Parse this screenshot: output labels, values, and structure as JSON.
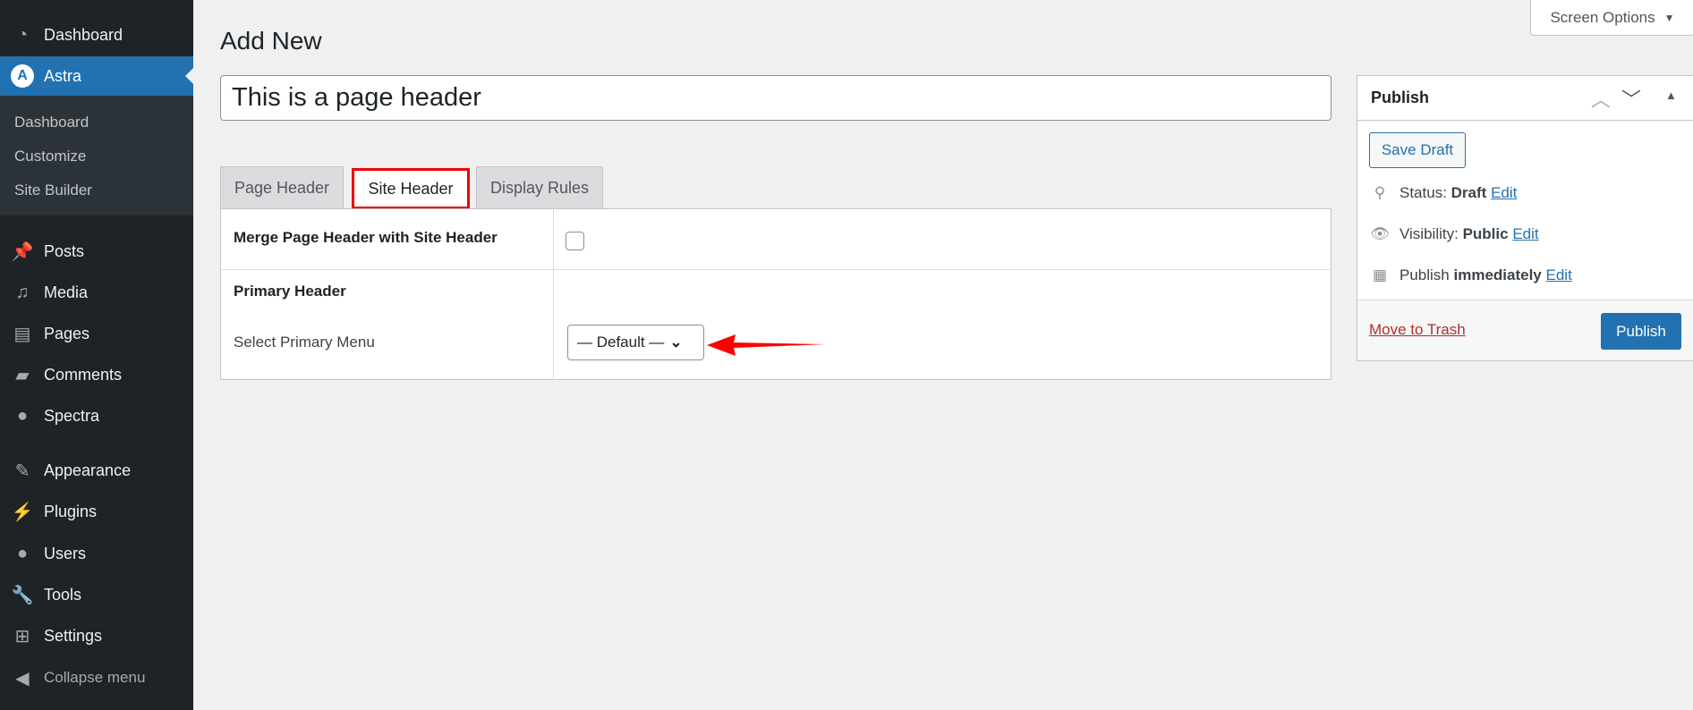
{
  "sidebar": {
    "items": [
      {
        "label": "Dashboard",
        "icon": "dashboard-icon"
      },
      {
        "label": "Astra",
        "icon": "astra-icon"
      },
      {
        "label": "Posts",
        "icon": "pin-icon"
      },
      {
        "label": "Media",
        "icon": "media-icon"
      },
      {
        "label": "Pages",
        "icon": "pages-icon"
      },
      {
        "label": "Comments",
        "icon": "comments-icon"
      },
      {
        "label": "Spectra",
        "icon": "spectra-icon"
      },
      {
        "label": "Appearance",
        "icon": "brush-icon"
      },
      {
        "label": "Plugins",
        "icon": "plugin-icon"
      },
      {
        "label": "Users",
        "icon": "user-icon"
      },
      {
        "label": "Tools",
        "icon": "wrench-icon"
      },
      {
        "label": "Settings",
        "icon": "settings-icon"
      }
    ],
    "submenu": [
      "Dashboard",
      "Customize",
      "Site Builder"
    ],
    "collapse": "Collapse menu"
  },
  "page": {
    "title": "Add New",
    "post_title": "This is a page header",
    "screen_options": "Screen Options"
  },
  "tabs": [
    "Page Header",
    "Site Header",
    "Display Rules"
  ],
  "settings": {
    "merge_label": "Merge Page Header with Site Header",
    "merge_checked": false,
    "primary_header": "Primary Header",
    "select_menu_label": "Select Primary Menu",
    "select_menu_value": "— Default —"
  },
  "publish": {
    "title": "Publish",
    "save_draft": "Save Draft",
    "status_label": "Status:",
    "status_value": "Draft",
    "visibility_label": "Visibility:",
    "visibility_value": "Public",
    "publish_label": "Publish",
    "publish_value": "immediately",
    "edit": "Edit",
    "trash": "Move to Trash",
    "publish_button": "Publish"
  },
  "colors": {
    "accent": "#2271b1",
    "sidebar": "#1d2327",
    "highlight": "#ff0000",
    "trash": "#b32d2e"
  }
}
